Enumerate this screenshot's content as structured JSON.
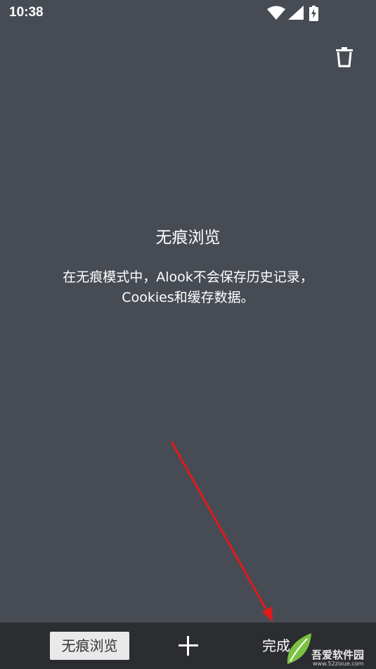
{
  "status_bar": {
    "time": "10:38",
    "icons": [
      "wifi-icon",
      "signal-icon",
      "battery-charging-icon"
    ]
  },
  "toolbar": {
    "delete_icon": "trash-icon"
  },
  "main": {
    "title": "无痕浏览",
    "description_line1": "在无痕模式中，Alook不会保存历史记录，",
    "description_line2": "Cookies和缓存数据。"
  },
  "bottom_bar": {
    "incognito_tab_label": "无痕浏览",
    "add_icon": "plus-icon",
    "done_label": "完成"
  },
  "watermark": {
    "text": "吾爱软件园",
    "url": "www.52zixue.com"
  },
  "colors": {
    "background": "#474c54",
    "bottom_bar": "#2b2d31",
    "tab_chip": "#e9e9e9",
    "arrow": "#e01a1a"
  }
}
